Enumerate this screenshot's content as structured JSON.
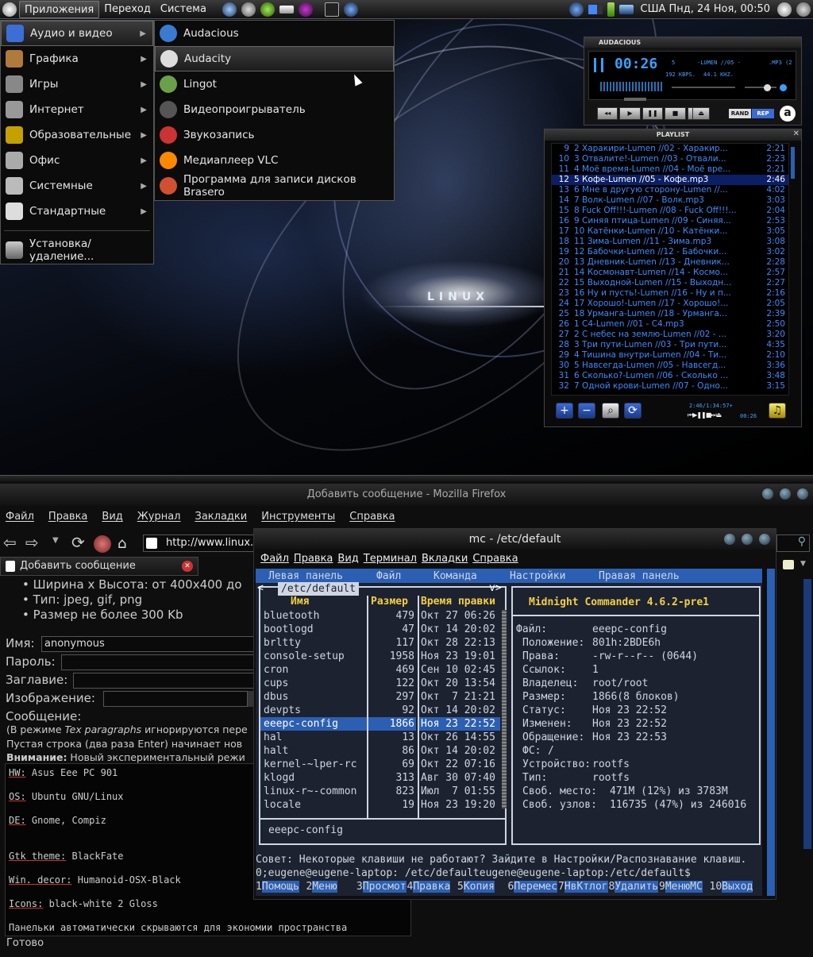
{
  "panel": {
    "menus": [
      "Приложения",
      "Переход",
      "Система"
    ],
    "clock": "США Пнд, 24 Ноя, 00:50"
  },
  "menu": {
    "items": [
      {
        "label": "Аудио и видео",
        "icon": "audio-video-icon",
        "color": "#3b6fd6"
      },
      {
        "label": "Графика",
        "icon": "graphics-icon",
        "color": "#b07a3a"
      },
      {
        "label": "Игры",
        "icon": "games-icon",
        "color": "#888888"
      },
      {
        "label": "Интернет",
        "icon": "internet-icon",
        "color": "#999999"
      },
      {
        "label": "Образовательные",
        "icon": "education-icon",
        "color": "#c4a000"
      },
      {
        "label": "Офис",
        "icon": "office-icon",
        "color": "#aaaaaa"
      },
      {
        "label": "Системные",
        "icon": "system-tools-icon",
        "color": "#bbbbbb"
      },
      {
        "label": "Стандартные",
        "icon": "accessories-icon",
        "color": "#dddddd"
      }
    ],
    "install": "Установка/удаление...",
    "sub": [
      {
        "label": "Audacious",
        "icon": "audacious-icon",
        "color": "#3a7ad0"
      },
      {
        "label": "Audacity",
        "icon": "audacity-icon",
        "color": "#dddddd"
      },
      {
        "label": "Lingot",
        "icon": "lingot-icon",
        "color": "#6aa04a"
      },
      {
        "label": "Видеопроигрыватель",
        "icon": "video-player-icon",
        "color": "#555555"
      },
      {
        "label": "Звукозапись",
        "icon": "sound-recorder-icon",
        "color": "#cc3333"
      },
      {
        "label": "Медиаплеер VLC",
        "icon": "vlc-icon",
        "color": "#ff8800"
      },
      {
        "label": "Программа для записи дисков Brasero",
        "icon": "brasero-icon",
        "color": "#d05030"
      }
    ]
  },
  "desktop": {
    "logo": "LINUX"
  },
  "audacious": {
    "title": "AUDACIOUS",
    "time": "00:26",
    "track": "5",
    "song": "-LUMEN //05 -",
    "ext": ".MP3 (2",
    "kbps": "192 KBPS.",
    "khz": "44.1 KHZ.",
    "rand": "RAND",
    "rep": "REP",
    "playlist_title": "PLAYLIST",
    "total": "2:46/1:34:57+",
    "pos": "00:26",
    "playlist": [
      {
        "n": "9",
        "t": "2 Харакири-Lumen //02 - Харакир...",
        "d": "2:21"
      },
      {
        "n": "10",
        "t": "3 Отвалите!-Lumen //03 - Отвали...",
        "d": "2:23"
      },
      {
        "n": "11",
        "t": "4 Моё время-Lumen //04 - Моё вре...",
        "d": "2:21"
      },
      {
        "n": "12",
        "t": "5 Кофе-Lumen //05 - Кофе.mp3",
        "d": "2:46"
      },
      {
        "n": "13",
        "t": "6 Мне в другую сторону-Lumen //...",
        "d": "4:02"
      },
      {
        "n": "14",
        "t": "7 Волк-Lumen //07 - Волк.mp3",
        "d": "3:03"
      },
      {
        "n": "15",
        "t": "8 Fuck Off!!!-Lumen //08 - Fuck Off!!!...",
        "d": "2:04"
      },
      {
        "n": "16",
        "t": "9 Синяя птица-Lumen //09 - Синяя...",
        "d": "2:53"
      },
      {
        "n": "17",
        "t": "10 Катёнки-Lumen //10 - Катёнки...",
        "d": "3:05"
      },
      {
        "n": "18",
        "t": "11 Зима-Lumen //11 - Зима.mp3",
        "d": "3:08"
      },
      {
        "n": "19",
        "t": "12 Бабочки-Lumen //12 - Бабочки...",
        "d": "3:02"
      },
      {
        "n": "20",
        "t": "13 Дневник-Lumen //13 - Дневник...",
        "d": "2:28"
      },
      {
        "n": "21",
        "t": "14 Космонавт-Lumen //14 - Космо...",
        "d": "2:57"
      },
      {
        "n": "22",
        "t": "15 Выходной-Lumen //15 - Выходн...",
        "d": "2:27"
      },
      {
        "n": "23",
        "t": "16 Ну и пусть!-Lumen //16 - Ну и п...",
        "d": "2:16"
      },
      {
        "n": "24",
        "t": "17 Хорошо!-Lumen //17 - Хорошо!...",
        "d": "2:05"
      },
      {
        "n": "25",
        "t": "18 Урманга-Lumen //18 - Урманга...",
        "d": "2:39"
      },
      {
        "n": "26",
        "t": "1 C4-Lumen //01 - C4.mp3",
        "d": "2:50"
      },
      {
        "n": "27",
        "t": "2 С небес на землю-Lumen //02 - ...",
        "d": "3:20"
      },
      {
        "n": "28",
        "t": "3 Три пути-Lumen //03 - Три пути...",
        "d": "4:35"
      },
      {
        "n": "29",
        "t": "4 Тишина внутри-Lumen //04 - Ти...",
        "d": "2:10"
      },
      {
        "n": "30",
        "t": "5 Навсегда-Lumen //05 - Навсегд...",
        "d": "3:36"
      },
      {
        "n": "31",
        "t": "6 Сколько?-Lumen //06 - Сколько ...",
        "d": "3:48"
      },
      {
        "n": "32",
        "t": "7 Одной крови-Lumen //07 - Одно...",
        "d": "3:15"
      }
    ]
  },
  "firefox": {
    "title": "Добавить сообщение - Mozilla Firefox",
    "menu": [
      "Файл",
      "Правка",
      "Вид",
      "Журнал",
      "Закладки",
      "Инструменты",
      "Справка"
    ],
    "url": "http://www.linux.o",
    "tab": "Добавить сообщение",
    "bullets": [
      "Ширина х Высота: от 400х400 до",
      "Тип: jpeg, gif, png",
      "Размер не более 300 Kb"
    ],
    "name_label": "Имя:",
    "name_value": "anonymous",
    "pass_label": "Пароль:",
    "subj_label": "Заглавие:",
    "img_label": "Изображение:",
    "msg_label": "Сообщение:",
    "help1_a": "(В режиме ",
    "help1_em": "Tex paragraphs",
    "help1_b": " игнорируются пере",
    "help2": "Пустая строка (два раза Enter) начинает нов",
    "help3_b": "Внимание:",
    "help3": " Новый экспериментальный режи",
    "text": [
      {
        "k": "HW:",
        "v": " Asus Eee PC 901"
      },
      {
        "k": "OS:",
        "v": " Ubuntu GNU/Linux"
      },
      {
        "k": "DE:",
        "v": " Gnome, Compiz"
      },
      {
        "k": "Gtk theme:",
        "v": " BlackFate"
      },
      {
        "k": "Win. decor:",
        "v": " Humanoid-OSX-Black"
      },
      {
        "k": "Icons:",
        "v": " black-white 2 Gloss"
      },
      {
        "k": "",
        "v": "Панельки автоматически скрываются для экономии пространства"
      }
    ],
    "status": "Готово"
  },
  "terminal": {
    "title": "mc - /etc/default",
    "menu": [
      "Файл",
      "Правка",
      "Вид",
      "Терминал",
      "Вкладки",
      "Справка"
    ],
    "mc_menu": [
      "Левая панель",
      "Файл",
      "Команда",
      "Настройки",
      "Правая панель"
    ],
    "path": "/etc/default",
    "cols": {
      "name": "Имя",
      "size": "Размер",
      "time": "Время правки"
    },
    "files": [
      {
        "name": "bluetooth",
        "size": "479",
        "time": "Окт 27 06:26"
      },
      {
        "name": "bootlogd",
        "size": "47",
        "time": "Окт 14 20:02"
      },
      {
        "name": "brltty",
        "size": "117",
        "time": "Окт 28 22:13"
      },
      {
        "name": "console-setup",
        "size": "1958",
        "time": "Ноя 23 19:01"
      },
      {
        "name": "cron",
        "size": "469",
        "time": "Сен 10 02:45"
      },
      {
        "name": "cups",
        "size": "122",
        "time": "Окт 20 13:54"
      },
      {
        "name": "dbus",
        "size": "297",
        "time": "Окт  7 21:21"
      },
      {
        "name": "devpts",
        "size": "92",
        "time": "Окт 14 20:02"
      },
      {
        "name": "eeepc-config",
        "size": "1866",
        "time": "Ноя 23 22:52"
      },
      {
        "name": "hal",
        "size": "13",
        "time": "Окт 26 14:55"
      },
      {
        "name": "halt",
        "size": "86",
        "time": "Окт 14 20:02"
      },
      {
        "name": "kernel-~lper-rc",
        "size": "69",
        "time": "Окт 22 07:16"
      },
      {
        "name": "klogd",
        "size": "313",
        "time": "Авг 30 07:40"
      },
      {
        "name": "linux-r~-common",
        "size": "823",
        "time": "Июл  7 01:55"
      },
      {
        "name": "locale",
        "size": "19",
        "time": "Ноя 23 19:20"
      }
    ],
    "mini": "eeepc-config",
    "info_title": "Midnight Commander 4.6.2-pre1",
    "info": [
      {
        "k": "Файл:",
        "v": "eeepc-config"
      },
      {
        "k": "Положение:",
        "v": "801h:2BDE6h"
      },
      {
        "k": "Права:",
        "v": "-rw-r--r-- (0644)"
      },
      {
        "k": "Ссылок:",
        "v": "1"
      },
      {
        "k": "Владелец:",
        "v": "root/root"
      },
      {
        "k": "Размер:",
        "v": "1866(8 блоков)"
      },
      {
        "k": "Статус:",
        "v": "Ноя 23 22:52"
      },
      {
        "k": "Изменен:",
        "v": "Ноя 23 22:52"
      },
      {
        "k": "Обращение:",
        "v": "Ноя 23 22:53"
      },
      {
        "k": "ФС:",
        "v": "/"
      },
      {
        "k": "Устройство:",
        "v": "rootfs"
      },
      {
        "k": "Тип:",
        "v": "rootfs"
      },
      {
        "k": "Своб. место:",
        "v": "471M (12%) из 3783M"
      },
      {
        "k": "Своб. узлов:",
        "v": "116735 (47%) из 246016"
      }
    ],
    "hint": "Совет: Некоторые клавиши не работают? Зайдите в Настройки/Распознавание клавиш.",
    "prompt": "0;eugene@eugene-laptop: /etc/defaulteugene@eugene-laptop:/etc/default$",
    "fkeys": [
      {
        "n": "1",
        "l": "Помощь"
      },
      {
        "n": "2",
        "l": "Меню"
      },
      {
        "n": "3",
        "l": "Просмот"
      },
      {
        "n": "4",
        "l": "Правка"
      },
      {
        "n": "5",
        "l": "Копия"
      },
      {
        "n": "6",
        "l": "Перемес"
      },
      {
        "n": "7",
        "l": "НвКтлог"
      },
      {
        "n": "8",
        "l": "Удалить"
      },
      {
        "n": "9",
        "l": "МенюМС"
      },
      {
        "n": "10",
        "l": "Выход"
      }
    ]
  },
  "colors": {
    "mc_blue": "#2b5fb3",
    "mc_bg": "#1c2230",
    "playlist_text": "#3c8cff",
    "menu_highlight": "#3c3c3c"
  }
}
